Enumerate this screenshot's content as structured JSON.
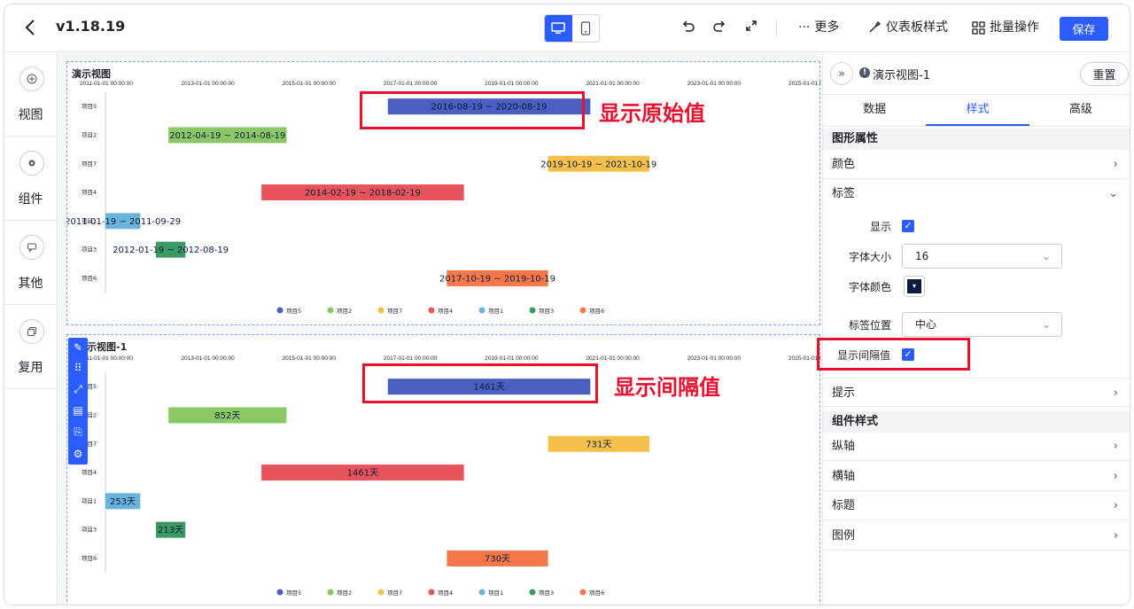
{
  "topbar": {
    "back_icon": "chevron-left-icon",
    "version": "v1.18.19",
    "more_label": "更多",
    "dashboard_style_label": "仪表板样式",
    "batch_label": "批量操作",
    "save_label": "保存",
    "accent_color": "#2b5cff"
  },
  "leftnav": {
    "items": [
      {
        "label": "视图",
        "icon": "plus-circle-icon"
      },
      {
        "label": "组件",
        "icon": "gear-icon"
      },
      {
        "label": "其他",
        "icon": "chat-icon"
      },
      {
        "label": "复用",
        "icon": "copy-icon"
      }
    ]
  },
  "charts": {
    "top_title": "演示视图",
    "bottom_title": "演示视图-1",
    "bottom_title_visible": "示视图-1",
    "x_ticks": [
      "2011-01-01 00:00:00",
      "2013-01-01 00:00:00",
      "2015-01-01 00:00:00",
      "2017-01-01 00:00:00",
      "2019-01-01 00:00:00",
      "2021-01-01 00:00:00",
      "2023-01-01 00:00:00",
      "2025-01-01 00:00:00"
    ],
    "tasks": [
      {
        "name": "项目5",
        "start": "2016-08-19",
        "end": "2020-08-19",
        "interval": "1461天",
        "color": "#4b5fc0"
      },
      {
        "name": "项目2",
        "start": "2012-04-19",
        "end": "2014-08-19",
        "interval": "852天",
        "color": "#8ac866"
      },
      {
        "name": "项目7",
        "start": "2019-10-19",
        "end": "2021-10-19",
        "interval": "731天",
        "color": "#f5c04a"
      },
      {
        "name": "项目4",
        "start": "2014-02-19",
        "end": "2018-02-19",
        "interval": "1461天",
        "color": "#e8545b"
      },
      {
        "name": "项目1",
        "start": "2011-01-19",
        "end": "2011-09-29",
        "interval": "253天",
        "color": "#6ab4dc"
      },
      {
        "name": "项目3",
        "start": "2012-01-19",
        "end": "2012-08-19",
        "interval": "213天",
        "color": "#3a9a62"
      },
      {
        "name": "项目6",
        "start": "2017-10-19",
        "end": "2019-10-19",
        "interval": "730天",
        "color": "#f5784a"
      }
    ],
    "range_separator": " ~ ",
    "axis_start": "2011-01-01",
    "axis_end": "2025-01-01"
  },
  "annotations": {
    "top": "显示原始值",
    "bottom": "显示间隔值",
    "color": "#e8112d"
  },
  "panel": {
    "view_name": "演示视图-1",
    "reset_label": "重置",
    "tabs": [
      "数据",
      "样式",
      "高级"
    ],
    "active_tab": "样式",
    "section_shape": "图形属性",
    "row_color": "颜色",
    "row_label": "标签",
    "show_label": "显示",
    "font_size_label": "字体大小",
    "font_size_value": "16",
    "font_color_label": "字体颜色",
    "font_color": "#0d1b3e",
    "label_pos_label": "标签位置",
    "label_pos_value": "中心",
    "show_interval_label": "显示间隔值",
    "row_tooltip": "提示",
    "section_component": "组件样式",
    "row_yaxis": "纵轴",
    "row_xaxis": "横轴",
    "row_title": "标题",
    "row_legend": "图例"
  }
}
